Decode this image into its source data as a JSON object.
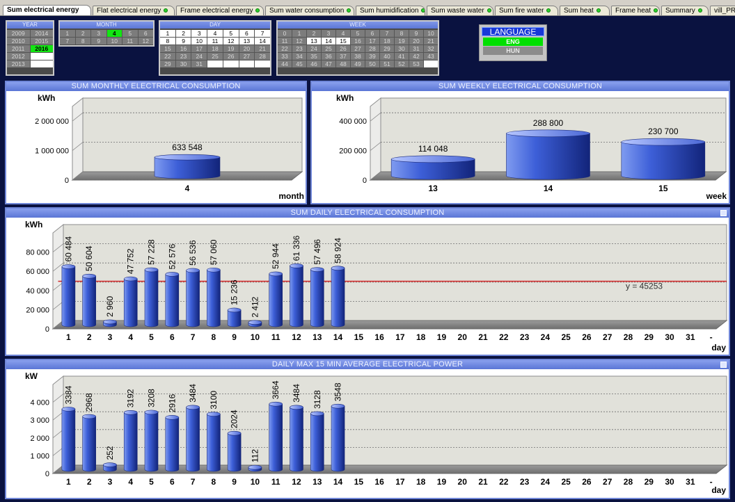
{
  "tabs": [
    {
      "label": "Sum electrical energy",
      "active": true,
      "dot": false
    },
    {
      "label": "Flat electrical energy",
      "active": false,
      "dot": true
    },
    {
      "label": "Frame electrical energy",
      "active": false,
      "dot": true
    },
    {
      "label": "Sum water consumption",
      "active": false,
      "dot": true
    },
    {
      "label": "Sum humidification",
      "active": false,
      "dot": true
    },
    {
      "label": "Sum waste water",
      "active": false,
      "dot": true
    },
    {
      "label": "Sum fire water",
      "active": false,
      "dot": true
    },
    {
      "label": "Sum heat",
      "active": false,
      "dot": true
    },
    {
      "label": "Frame heat",
      "active": false,
      "dot": true
    },
    {
      "label": "Summary",
      "active": false,
      "dot": true
    },
    {
      "label": "vill_PRINT",
      "active": false,
      "dot": false
    }
  ],
  "selectors": {
    "year": {
      "title": "YEAR",
      "cells": [
        "2009",
        "2014",
        "2010",
        "2015",
        "2011",
        "2016",
        "2012",
        "",
        "2013",
        ""
      ],
      "selected": "2016"
    },
    "month": {
      "title": "MONTH",
      "cells": [
        "1",
        "2",
        "3",
        "4",
        "5",
        "6",
        "7",
        "8",
        "9",
        "10",
        "11",
        "12"
      ],
      "selected": "4"
    },
    "day": {
      "title": "DAY",
      "cells": [
        "1",
        "2",
        "3",
        "4",
        "5",
        "6",
        "7",
        "8",
        "9",
        "10",
        "11",
        "12",
        "13",
        "14",
        "15",
        "16",
        "17",
        "18",
        "19",
        "20",
        "21",
        "22",
        "23",
        "24",
        "25",
        "26",
        "27",
        "28",
        "29",
        "30",
        "31",
        "",
        "",
        "",
        ""
      ],
      "active_days": 14
    },
    "week": {
      "title": "WEEK",
      "cells": [
        "0",
        "1",
        "2",
        "3",
        "4",
        "5",
        "6",
        "7",
        "8",
        "9",
        "10",
        "11",
        "12",
        "13",
        "14",
        "15",
        "16",
        "17",
        "18",
        "19",
        "20",
        "21",
        "22",
        "23",
        "24",
        "25",
        "26",
        "27",
        "28",
        "29",
        "30",
        "31",
        "32",
        "33",
        "34",
        "35",
        "36",
        "37",
        "38",
        "39",
        "40",
        "41",
        "42",
        "43",
        "44",
        "45",
        "46",
        "47",
        "48",
        "49",
        "50",
        "51",
        "52",
        "53",
        ""
      ],
      "highlighted": [
        "13",
        "14",
        "15"
      ]
    }
  },
  "language": {
    "title": "LANGUAGE",
    "eng": "ENG",
    "hun": "HUN",
    "selected": "ENG"
  },
  "colors": {
    "accent": "#5a75d5",
    "bar": "#2a47c4",
    "selected_cell": "#13e613",
    "average_line": "#d43030"
  },
  "panels": {
    "monthly": {
      "title": "SUM MONTHLY ELECTRICAL CONSUMPTION"
    },
    "weekly": {
      "title": "SUM WEEKLY ELECTRICAL CONSUMPTION"
    },
    "daily": {
      "title": "SUM DAILY ELECTRICAL CONSUMPTION"
    },
    "power": {
      "title": "DAILY MAX 15 MIN AVERAGE ELECTRICAL POWER"
    }
  },
  "chart_data": [
    {
      "id": "monthly",
      "type": "bar",
      "ylabel": "kWh",
      "xlabel": "month",
      "categories": [
        "4"
      ],
      "values": [
        633548
      ],
      "value_labels": [
        "633 548"
      ],
      "ylim": [
        0,
        2500000
      ],
      "yticks": [
        0,
        1000000,
        2000000
      ],
      "ytick_labels": [
        "0",
        "1 000 000",
        "2 000 000"
      ],
      "grid": true
    },
    {
      "id": "weekly",
      "type": "bar",
      "ylabel": "kWh",
      "xlabel": "week",
      "categories": [
        "13",
        "14",
        "15"
      ],
      "values": [
        114048,
        288800,
        230700
      ],
      "value_labels": [
        "114 048",
        "288 800",
        "230 700"
      ],
      "ylim": [
        0,
        500000
      ],
      "yticks": [
        0,
        200000,
        400000
      ],
      "ytick_labels": [
        "0",
        "200 000",
        "400 000"
      ],
      "grid": true
    },
    {
      "id": "daily",
      "type": "bar",
      "ylabel": "kWh",
      "xlabel": "day",
      "categories": [
        "1",
        "2",
        "3",
        "4",
        "5",
        "6",
        "7",
        "8",
        "9",
        "10",
        "11",
        "12",
        "13",
        "14",
        "15",
        "16",
        "17",
        "18",
        "19",
        "20",
        "21",
        "22",
        "23",
        "24",
        "25",
        "26",
        "27",
        "28",
        "29",
        "30",
        "31",
        "-"
      ],
      "values": [
        60484,
        50604,
        2960,
        47752,
        57228,
        52576,
        56536,
        57060,
        15236,
        2412,
        52944,
        61336,
        57496,
        58924
      ],
      "value_labels": [
        "60 484",
        "50 604",
        "2 960",
        "47 752",
        "57 228",
        "52 576",
        "56 536",
        "57 060",
        "15 236",
        "2 412",
        "52 944",
        "61 336",
        "57 496",
        "58 924"
      ],
      "ylim": [
        0,
        100000
      ],
      "yticks": [
        0,
        20000,
        40000,
        60000,
        80000
      ],
      "ytick_labels": [
        "0",
        "20 000",
        "40 000",
        "60 000",
        "80 000"
      ],
      "average_line": {
        "value": 45253,
        "label": "y = 45253"
      },
      "grid": true
    },
    {
      "id": "power",
      "type": "bar",
      "ylabel": "kW",
      "xlabel": "day",
      "categories": [
        "1",
        "2",
        "3",
        "4",
        "5",
        "6",
        "7",
        "8",
        "9",
        "10",
        "11",
        "12",
        "13",
        "14",
        "15",
        "16",
        "17",
        "18",
        "19",
        "20",
        "21",
        "22",
        "23",
        "24",
        "25",
        "26",
        "27",
        "28",
        "29",
        "30",
        "31",
        "-"
      ],
      "values": [
        3384,
        2968,
        252,
        3192,
        3208,
        2916,
        3484,
        3100,
        2024,
        112,
        3664,
        3484,
        3128,
        3548
      ],
      "value_labels": [
        "3384",
        "2968",
        "252",
        "3192",
        "3208",
        "2916",
        "3484",
        "3100",
        "2024",
        "112",
        "3664",
        "3484",
        "3128",
        "3548"
      ],
      "ylim": [
        0,
        5000
      ],
      "yticks": [
        0,
        1000,
        2000,
        3000,
        4000
      ],
      "ytick_labels": [
        "0",
        "1 000",
        "2 000",
        "3 000",
        "4 000"
      ],
      "grid": true
    }
  ]
}
